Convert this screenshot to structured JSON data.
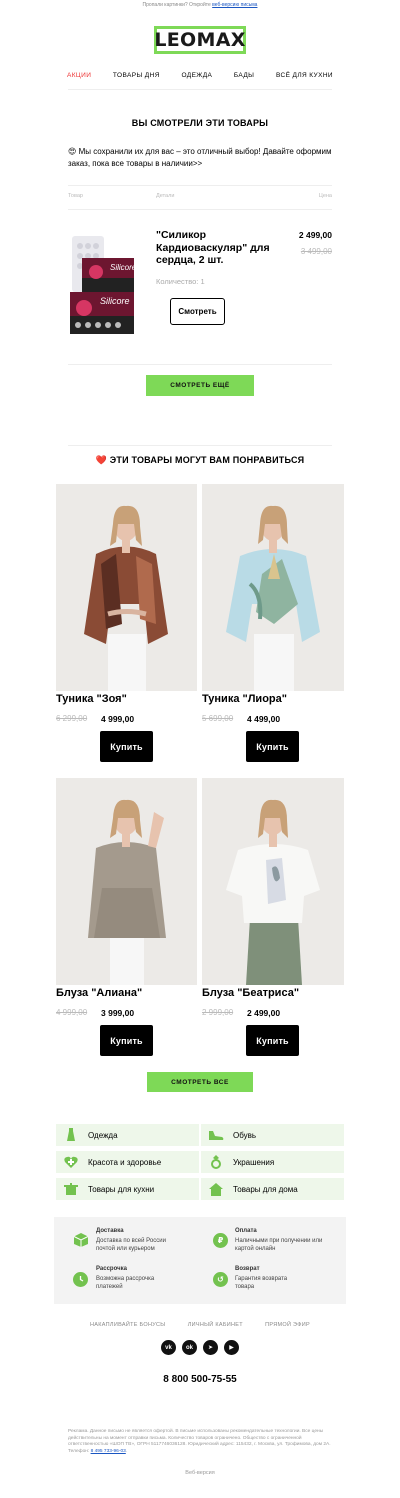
{
  "preheader": {
    "text": "Пропали картинки? Откройте",
    "link": "веб-версию письма"
  },
  "logo": "LEOMAX",
  "nav": [
    "АКЦИИ",
    "ТОВАРЫ ДНЯ",
    "ОДЕЖДА",
    "БАДЫ",
    "ВСЁ ДЛЯ КУХНИ"
  ],
  "viewed": {
    "title": "ВЫ СМОТРЕЛИ ЭТИ ТОВАРЫ",
    "intro_emoji": "😍",
    "intro": "Мы сохранили их для вас – это отличный выбор! Давайте оформим заказ, пока все товары в наличии>>",
    "columns": {
      "product": "Товар",
      "details": "Детали",
      "price": "Цена"
    },
    "product": {
      "name": "\"Силикор Кардиоваскуляр\" для сердца, 2 шт.",
      "price": "2 499,00",
      "old_price": "3 499,00",
      "qty": "Количество: 1",
      "button": "Смотреть",
      "pack_label": "Silicore"
    },
    "more_button": "СМОТРЕТЬ ЕЩЁ"
  },
  "recommend": {
    "title": "ЭТИ ТОВАРЫ МОГУТ ВАМ ПОНРАВИТЬСЯ",
    "heart": "❤️",
    "items": [
      {
        "name": "Туника \"Зоя\"",
        "old": "6 299,00",
        "price": "4 999,00",
        "button": "Купить"
      },
      {
        "name": "Туника \"Лиора\"",
        "old": "5 699,00",
        "price": "4 499,00",
        "button": "Купить"
      },
      {
        "name": "Блуза \"Алиана\"",
        "old": "4 999,00",
        "price": "3 999,00",
        "button": "Купить"
      },
      {
        "name": "Блуза \"Беатриса\"",
        "old": "2 999,00",
        "price": "2 499,00",
        "button": "Купить"
      }
    ],
    "all_button": "СМОТРЕТЬ ВСЕ"
  },
  "categories": [
    {
      "label": "Одежда",
      "icon": "dress-icon"
    },
    {
      "label": "Обувь",
      "icon": "shoe-icon"
    },
    {
      "label": "Красота и здоровье",
      "icon": "heart-plus-icon"
    },
    {
      "label": "Украшения",
      "icon": "ring-icon"
    },
    {
      "label": "Товары для кухни",
      "icon": "pot-icon"
    },
    {
      "label": "Товары для дома",
      "icon": "house-icon"
    }
  ],
  "info": [
    {
      "title": "Доставка",
      "text": "Доставка по всей России почтой или курьером",
      "icon": "box-icon"
    },
    {
      "title": "Оплата",
      "text": "Наличными при получении или картой онлайн",
      "icon": "ruble-icon"
    },
    {
      "title": "Рассрочка",
      "text": "Возможна рассрочка платежей",
      "icon": "clock-icon"
    },
    {
      "title": "Возврат",
      "text": "Гарантия возврата товара",
      "icon": "return-icon"
    }
  ],
  "footer_links": [
    "НАКАПЛИВАЙТЕ БОНУСЫ",
    "ЛИЧНЫЙ КАБИНЕТ",
    "ПРЯМОЙ ЭФИР"
  ],
  "social": [
    {
      "name": "vk-icon",
      "glyph": "vk"
    },
    {
      "name": "ok-icon",
      "glyph": "ok"
    },
    {
      "name": "telegram-icon",
      "glyph": "➤"
    },
    {
      "name": "youtube-icon",
      "glyph": "▶"
    }
  ],
  "phone": "8 800 500-75-55",
  "legal": "Реклама. Данное письмо не является офертой. В письме использованы рекомендательные технологии. Все цены действительны на момент отправки письма. Количество товаров ограничено. Общество с ограниченной ответственностью «ШОП ТВ», ОГРН 5117746036128. Юридический адрес: 115432, г. Москва, ул. Трофимова, дом 2А. Телефон:",
  "legal_phone": "8 495 733-96-03",
  "web_version": "Веб-версия",
  "colors": {
    "accent_green": "#7ed957",
    "nav_active": "#e33333",
    "category_bg": "#eef7ea",
    "icon_green": "#73c24f"
  }
}
